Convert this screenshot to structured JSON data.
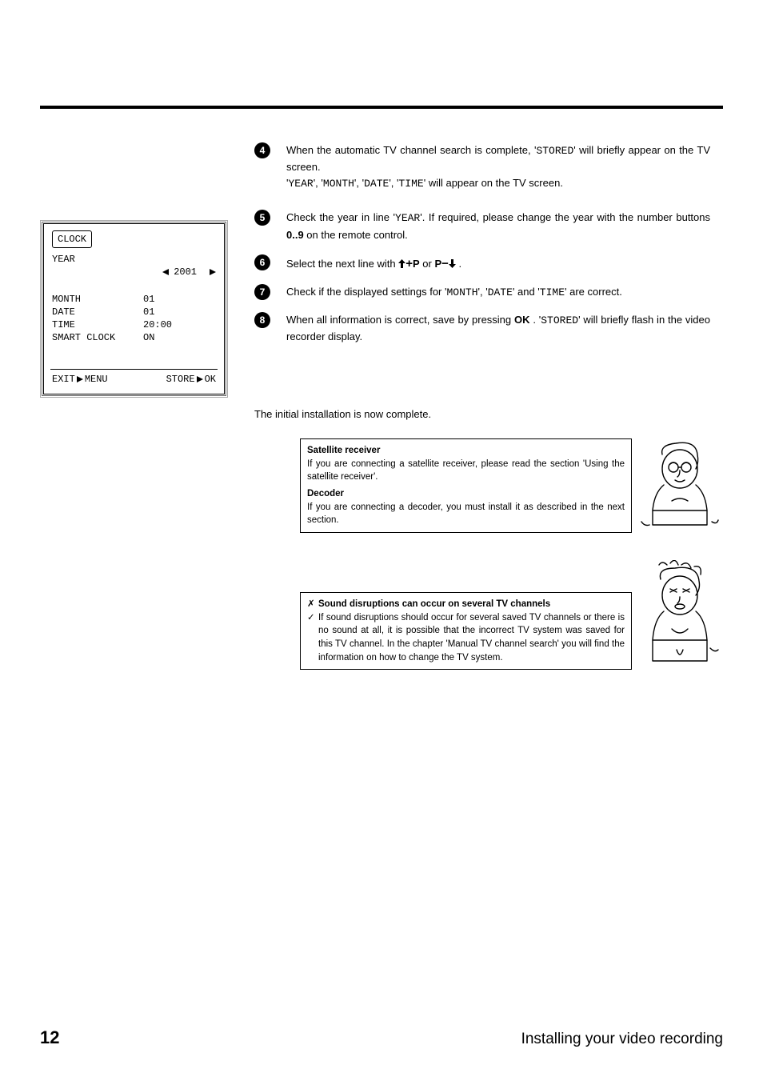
{
  "osd": {
    "title": "CLOCK",
    "rows": [
      {
        "label": "YEAR",
        "value": "2001",
        "arrows": true
      },
      {
        "label": "MONTH",
        "value": "01",
        "arrows": false
      },
      {
        "label": "DATE",
        "value": "01",
        "arrows": false
      },
      {
        "label": "TIME",
        "value": "20:00",
        "arrows": false
      },
      {
        "label": "SMART CLOCK",
        "value": "ON",
        "arrows": false
      }
    ],
    "footer_exit": "EXIT",
    "footer_menu": "MENU",
    "footer_store": "STORE",
    "footer_ok": "OK"
  },
  "steps": {
    "s4a": "When the automatic TV channel search is complete, '",
    "s4_stored": "STORED",
    "s4b": "' will briefly appear on the TV screen.",
    "s4c_pre": "'",
    "s4_year": "YEAR",
    "s4_sep1": "', '",
    "s4_month": "MONTH",
    "s4_sep2": "', '",
    "s4_date": "DATE",
    "s4_sep3": "', '",
    "s4_time": "TIME",
    "s4c_post": "' will appear on the TV screen.",
    "s5a": "Check the year in line '",
    "s5_year": "YEAR",
    "s5b": "'. If required, please change the year with the number buttons ",
    "s5_btn": "0..9",
    "s5c": " on the remote control.",
    "s6a": "Select the next line with ",
    "s6_p": "P",
    "s6_or": " or ",
    "s6_dot": " .",
    "s7a": "Check if the displayed settings for '",
    "s7_month": "MONTH",
    "s7_sep1": "', '",
    "s7_date": "DATE",
    "s7_sep2": "' and '",
    "s7_time": "TIME",
    "s7b": "' are correct.",
    "s8a": "When all information is correct, save by pressing ",
    "s8_ok": "OK",
    "s8b": " . '",
    "s8_stored": "STORED",
    "s8c": "' will briefly flash in the video recorder display."
  },
  "intro_done": "The initial installation is now complete.",
  "info1": {
    "title1": "Satellite receiver",
    "text1": "If you are connecting a satellite receiver, please read the section 'Using the satellite receiver'.",
    "title2": "Decoder",
    "text2": "If you are connecting a decoder, you must install it as described in the next section."
  },
  "info2": {
    "cross": "✗",
    "header": "Sound disruptions can occur on several TV channels",
    "check": "✓",
    "body": "If sound disruptions should occur for several saved TV channels or there is no sound at all, it is possible that the incorrect TV system was saved for this TV channel. In the chapter 'Manual TV channel search' you will find the information on how to change the TV system."
  },
  "footer": {
    "page": "12",
    "title": "Installing your video recording"
  }
}
